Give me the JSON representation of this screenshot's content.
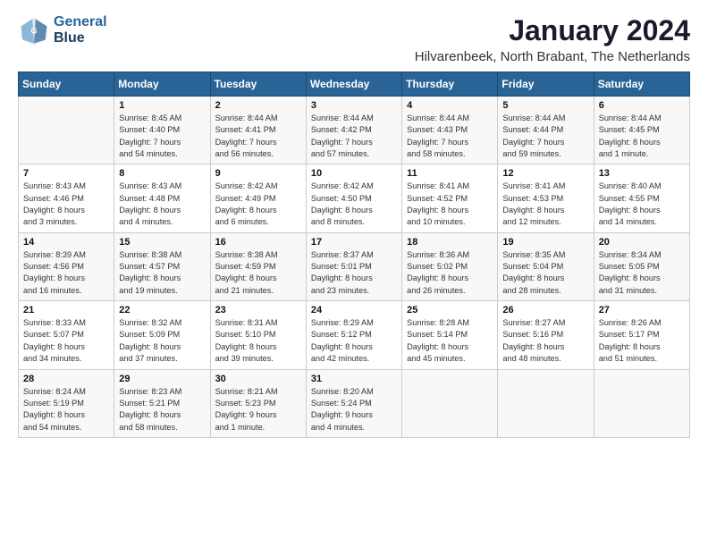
{
  "header": {
    "logo_line1": "General",
    "logo_line2": "Blue",
    "title": "January 2024",
    "subtitle": "Hilvarenbeek, North Brabant, The Netherlands"
  },
  "days": [
    "Sunday",
    "Monday",
    "Tuesday",
    "Wednesday",
    "Thursday",
    "Friday",
    "Saturday"
  ],
  "weeks": [
    [
      {
        "date": "",
        "lines": []
      },
      {
        "date": "1",
        "lines": [
          "Sunrise: 8:45 AM",
          "Sunset: 4:40 PM",
          "Daylight: 7 hours",
          "and 54 minutes."
        ]
      },
      {
        "date": "2",
        "lines": [
          "Sunrise: 8:44 AM",
          "Sunset: 4:41 PM",
          "Daylight: 7 hours",
          "and 56 minutes."
        ]
      },
      {
        "date": "3",
        "lines": [
          "Sunrise: 8:44 AM",
          "Sunset: 4:42 PM",
          "Daylight: 7 hours",
          "and 57 minutes."
        ]
      },
      {
        "date": "4",
        "lines": [
          "Sunrise: 8:44 AM",
          "Sunset: 4:43 PM",
          "Daylight: 7 hours",
          "and 58 minutes."
        ]
      },
      {
        "date": "5",
        "lines": [
          "Sunrise: 8:44 AM",
          "Sunset: 4:44 PM",
          "Daylight: 7 hours",
          "and 59 minutes."
        ]
      },
      {
        "date": "6",
        "lines": [
          "Sunrise: 8:44 AM",
          "Sunset: 4:45 PM",
          "Daylight: 8 hours",
          "and 1 minute."
        ]
      }
    ],
    [
      {
        "date": "7",
        "lines": [
          "Sunrise: 8:43 AM",
          "Sunset: 4:46 PM",
          "Daylight: 8 hours",
          "and 3 minutes."
        ]
      },
      {
        "date": "8",
        "lines": [
          "Sunrise: 8:43 AM",
          "Sunset: 4:48 PM",
          "Daylight: 8 hours",
          "and 4 minutes."
        ]
      },
      {
        "date": "9",
        "lines": [
          "Sunrise: 8:42 AM",
          "Sunset: 4:49 PM",
          "Daylight: 8 hours",
          "and 6 minutes."
        ]
      },
      {
        "date": "10",
        "lines": [
          "Sunrise: 8:42 AM",
          "Sunset: 4:50 PM",
          "Daylight: 8 hours",
          "and 8 minutes."
        ]
      },
      {
        "date": "11",
        "lines": [
          "Sunrise: 8:41 AM",
          "Sunset: 4:52 PM",
          "Daylight: 8 hours",
          "and 10 minutes."
        ]
      },
      {
        "date": "12",
        "lines": [
          "Sunrise: 8:41 AM",
          "Sunset: 4:53 PM",
          "Daylight: 8 hours",
          "and 12 minutes."
        ]
      },
      {
        "date": "13",
        "lines": [
          "Sunrise: 8:40 AM",
          "Sunset: 4:55 PM",
          "Daylight: 8 hours",
          "and 14 minutes."
        ]
      }
    ],
    [
      {
        "date": "14",
        "lines": [
          "Sunrise: 8:39 AM",
          "Sunset: 4:56 PM",
          "Daylight: 8 hours",
          "and 16 minutes."
        ]
      },
      {
        "date": "15",
        "lines": [
          "Sunrise: 8:38 AM",
          "Sunset: 4:57 PM",
          "Daylight: 8 hours",
          "and 19 minutes."
        ]
      },
      {
        "date": "16",
        "lines": [
          "Sunrise: 8:38 AM",
          "Sunset: 4:59 PM",
          "Daylight: 8 hours",
          "and 21 minutes."
        ]
      },
      {
        "date": "17",
        "lines": [
          "Sunrise: 8:37 AM",
          "Sunset: 5:01 PM",
          "Daylight: 8 hours",
          "and 23 minutes."
        ]
      },
      {
        "date": "18",
        "lines": [
          "Sunrise: 8:36 AM",
          "Sunset: 5:02 PM",
          "Daylight: 8 hours",
          "and 26 minutes."
        ]
      },
      {
        "date": "19",
        "lines": [
          "Sunrise: 8:35 AM",
          "Sunset: 5:04 PM",
          "Daylight: 8 hours",
          "and 28 minutes."
        ]
      },
      {
        "date": "20",
        "lines": [
          "Sunrise: 8:34 AM",
          "Sunset: 5:05 PM",
          "Daylight: 8 hours",
          "and 31 minutes."
        ]
      }
    ],
    [
      {
        "date": "21",
        "lines": [
          "Sunrise: 8:33 AM",
          "Sunset: 5:07 PM",
          "Daylight: 8 hours",
          "and 34 minutes."
        ]
      },
      {
        "date": "22",
        "lines": [
          "Sunrise: 8:32 AM",
          "Sunset: 5:09 PM",
          "Daylight: 8 hours",
          "and 37 minutes."
        ]
      },
      {
        "date": "23",
        "lines": [
          "Sunrise: 8:31 AM",
          "Sunset: 5:10 PM",
          "Daylight: 8 hours",
          "and 39 minutes."
        ]
      },
      {
        "date": "24",
        "lines": [
          "Sunrise: 8:29 AM",
          "Sunset: 5:12 PM",
          "Daylight: 8 hours",
          "and 42 minutes."
        ]
      },
      {
        "date": "25",
        "lines": [
          "Sunrise: 8:28 AM",
          "Sunset: 5:14 PM",
          "Daylight: 8 hours",
          "and 45 minutes."
        ]
      },
      {
        "date": "26",
        "lines": [
          "Sunrise: 8:27 AM",
          "Sunset: 5:16 PM",
          "Daylight: 8 hours",
          "and 48 minutes."
        ]
      },
      {
        "date": "27",
        "lines": [
          "Sunrise: 8:26 AM",
          "Sunset: 5:17 PM",
          "Daylight: 8 hours",
          "and 51 minutes."
        ]
      }
    ],
    [
      {
        "date": "28",
        "lines": [
          "Sunrise: 8:24 AM",
          "Sunset: 5:19 PM",
          "Daylight: 8 hours",
          "and 54 minutes."
        ]
      },
      {
        "date": "29",
        "lines": [
          "Sunrise: 8:23 AM",
          "Sunset: 5:21 PM",
          "Daylight: 8 hours",
          "and 58 minutes."
        ]
      },
      {
        "date": "30",
        "lines": [
          "Sunrise: 8:21 AM",
          "Sunset: 5:23 PM",
          "Daylight: 9 hours",
          "and 1 minute."
        ]
      },
      {
        "date": "31",
        "lines": [
          "Sunrise: 8:20 AM",
          "Sunset: 5:24 PM",
          "Daylight: 9 hours",
          "and 4 minutes."
        ]
      },
      {
        "date": "",
        "lines": []
      },
      {
        "date": "",
        "lines": []
      },
      {
        "date": "",
        "lines": []
      }
    ]
  ]
}
